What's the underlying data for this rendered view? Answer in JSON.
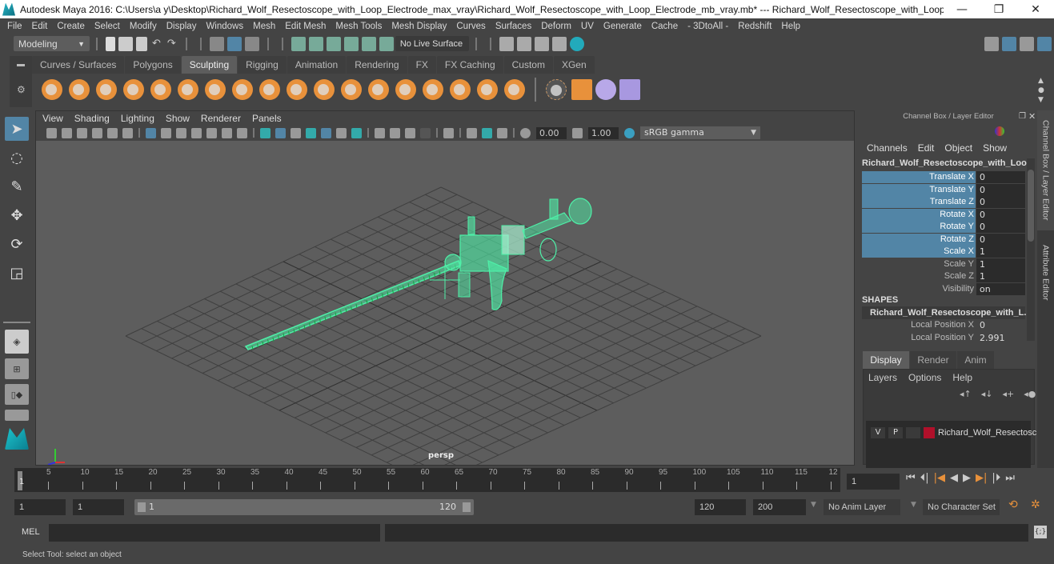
{
  "window": {
    "title": "Autodesk Maya 2016: C:\\Users\\a y\\Desktop\\Richard_Wolf_Resectoscope_with_Loop_Electrode_max_vray\\Richard_Wolf_Resectoscope_with_Loop_Electrode_mb_vray.mb*  ---  Richard_Wolf_Resectoscope_with_Loop_Electrode...",
    "minimize": "—",
    "restore": "❐",
    "close": "✕"
  },
  "menubar": [
    "File",
    "Edit",
    "Create",
    "Select",
    "Modify",
    "Display",
    "Windows",
    "Mesh",
    "Edit Mesh",
    "Mesh Tools",
    "Mesh Display",
    "Curves",
    "Surfaces",
    "Deform",
    "UV",
    "Generate",
    "Cache",
    "- 3DtoAll -",
    "Redshift",
    "Help"
  ],
  "statusline": {
    "workspace": "Modeling",
    "live_surface": "No Live Surface"
  },
  "shelf": {
    "tabs": [
      "Curves / Surfaces",
      "Polygons",
      "Sculpting",
      "Rigging",
      "Animation",
      "Rendering",
      "FX",
      "FX Caching",
      "Custom",
      "XGen"
    ],
    "active_tab": "Sculpting",
    "tools": [
      "sculpt",
      "smooth",
      "relax",
      "grab",
      "pinch",
      "flatten",
      "foamy",
      "spray",
      "repeat",
      "imprint",
      "wax",
      "scrape",
      "fill",
      "knife",
      "smear",
      "bulge",
      "amplify",
      "freeze"
    ],
    "extra_tools": [
      "convert-to-frozen",
      "sculpt-object-set",
      "mesh-sculpt",
      "sculpt-settings"
    ]
  },
  "viewport": {
    "menus": [
      "View",
      "Shading",
      "Lighting",
      "Show",
      "Renderer",
      "Panels"
    ],
    "exposure": "0.00",
    "gamma": "1.00",
    "color_space": "sRGB gamma",
    "camera_label": "persp",
    "wire_color": "#4ef0a8",
    "axis": {
      "x": "X",
      "y": "Y",
      "z": "Z"
    }
  },
  "channel_box": {
    "title": "Channel Box / Layer Editor",
    "menus": [
      "Channels",
      "Edit",
      "Object",
      "Show"
    ],
    "object_name": "Richard_Wolf_Resectoscope_with_Loo...",
    "channels": [
      {
        "label": "Translate X",
        "value": "0",
        "selected": true
      },
      {
        "label": "Translate Y",
        "value": "0",
        "selected": true
      },
      {
        "label": "Translate Z",
        "value": "0",
        "selected": true
      },
      {
        "label": "Rotate X",
        "value": "0",
        "selected": true
      },
      {
        "label": "Rotate Y",
        "value": "0",
        "selected": true
      },
      {
        "label": "Rotate Z",
        "value": "0",
        "selected": true
      },
      {
        "label": "Scale X",
        "value": "1",
        "selected": true
      },
      {
        "label": "Scale Y",
        "value": "1",
        "selected": false
      },
      {
        "label": "Scale Z",
        "value": "1",
        "selected": false
      },
      {
        "label": "Visibility",
        "value": "on",
        "selected": false
      }
    ],
    "shapes_header": "SHAPES",
    "shape_name": "Richard_Wolf_Resectoscope_with_L...",
    "shape_channels": [
      {
        "label": "Local Position X",
        "value": "0"
      },
      {
        "label": "Local Position Y",
        "value": "2.991"
      }
    ]
  },
  "side_tabs": [
    "Channel Box / Layer Editor",
    "Attribute Editor"
  ],
  "layer_editor": {
    "tabs": [
      "Display",
      "Render",
      "Anim"
    ],
    "active_tab": "Display",
    "menus": [
      "Layers",
      "Options",
      "Help"
    ],
    "layers": [
      {
        "v": "V",
        "p": "P",
        "color": "#b0102a",
        "name": "Richard_Wolf_Resectosc"
      }
    ]
  },
  "timeline": {
    "ticks": [
      "5",
      "10",
      "15",
      "20",
      "25",
      "30",
      "35",
      "40",
      "45",
      "50",
      "55",
      "60",
      "65",
      "70",
      "75",
      "80",
      "85",
      "90",
      "95",
      "100",
      "105",
      "110",
      "115",
      "12"
    ],
    "current_marker": "1",
    "current_frame": "1"
  },
  "range": {
    "start": "1",
    "playback_start": "1",
    "slider_start": "1",
    "slider_end": "120",
    "playback_end": "120",
    "end": "200",
    "anim_layer": "No Anim Layer",
    "character_set": "No Character Set"
  },
  "command_line": {
    "label": "MEL"
  },
  "help_line": "Select Tool: select an object"
}
